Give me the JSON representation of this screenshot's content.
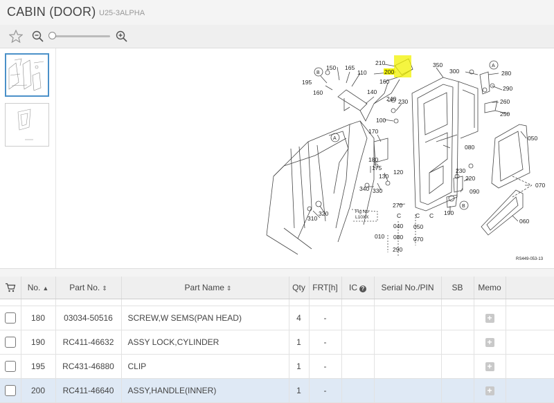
{
  "header": {
    "title": "CABIN (DOOR)",
    "subtitle": "U25-3ALPHA"
  },
  "toolbar": {
    "icons": [
      "star-icon",
      "zoom-out-icon",
      "zoom-slider",
      "zoom-in-icon"
    ]
  },
  "colors": {
    "selected_row": "#dfe9f5",
    "highlight": "#f2f200",
    "thumb_border": "#4a90c8"
  },
  "diagram": {
    "callouts": [
      "210",
      "200",
      "350",
      "300",
      "280",
      "290",
      "260",
      "250",
      "150",
      "165",
      "110",
      "195",
      "160",
      "140",
      "160",
      "240",
      "230",
      "100",
      "170",
      "050",
      "080",
      "230",
      "220",
      "090",
      "070",
      "060",
      "180",
      "175",
      "120",
      "130",
      "340",
      "330",
      "270",
      "190",
      "320",
      "310",
      "010",
      "040",
      "050",
      "080",
      "070",
      "290"
    ],
    "ref_markers": [
      "B",
      "A",
      "A",
      "B"
    ],
    "note": "Fig No\nL10XX",
    "code": "RS449-053-13",
    "highlighted_part": "200"
  },
  "table": {
    "columns": {
      "cart": "",
      "no": "No.",
      "part_no": "Part No.",
      "part_name": "Part Name",
      "qty": "Qty",
      "frt": "FRT[h]",
      "ic": "IC",
      "serial": "Serial No./PIN",
      "sb": "SB",
      "memo": "Memo"
    },
    "rows": [
      {
        "no": "180",
        "part_no": "03034-50516",
        "part_name": "SCREW,W SEMS(PAN HEAD)",
        "qty": "4",
        "frt": "-",
        "ic": "",
        "serial": "",
        "sb": "",
        "selected": false
      },
      {
        "no": "190",
        "part_no": "RC411-46632",
        "part_name": "ASSY LOCK,CYLINDER",
        "qty": "1",
        "frt": "-",
        "ic": "",
        "serial": "",
        "sb": "",
        "selected": false
      },
      {
        "no": "195",
        "part_no": "RC431-46880",
        "part_name": "CLIP",
        "qty": "1",
        "frt": "-",
        "ic": "",
        "serial": "",
        "sb": "",
        "selected": false
      },
      {
        "no": "200",
        "part_no": "RC411-46640",
        "part_name": "ASSY,HANDLE(INNER)",
        "qty": "1",
        "frt": "-",
        "ic": "",
        "serial": "",
        "sb": "",
        "selected": true
      }
    ]
  }
}
